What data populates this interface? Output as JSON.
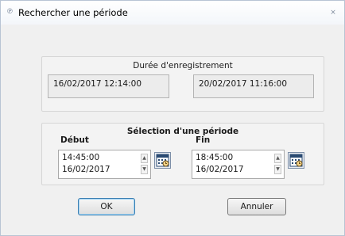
{
  "window": {
    "title": "Rechercher une période",
    "app_icon": "app-icon",
    "close_label": "✕"
  },
  "recording": {
    "title": "Durée d'enregistrement",
    "start": "16/02/2017 12:14:00",
    "end": "20/02/2017 11:16:00"
  },
  "selection": {
    "title": "Sélection d'une période",
    "start": {
      "label": "Début",
      "time": "14:45:00",
      "date": "16/02/2017",
      "calendar_icon": "calendar-clock-icon"
    },
    "end": {
      "label": "Fin",
      "time": "18:45:00",
      "date": "16/02/2017",
      "calendar_icon": "calendar-clock-icon"
    }
  },
  "buttons": {
    "ok": "OK",
    "cancel": "Annuler"
  }
}
